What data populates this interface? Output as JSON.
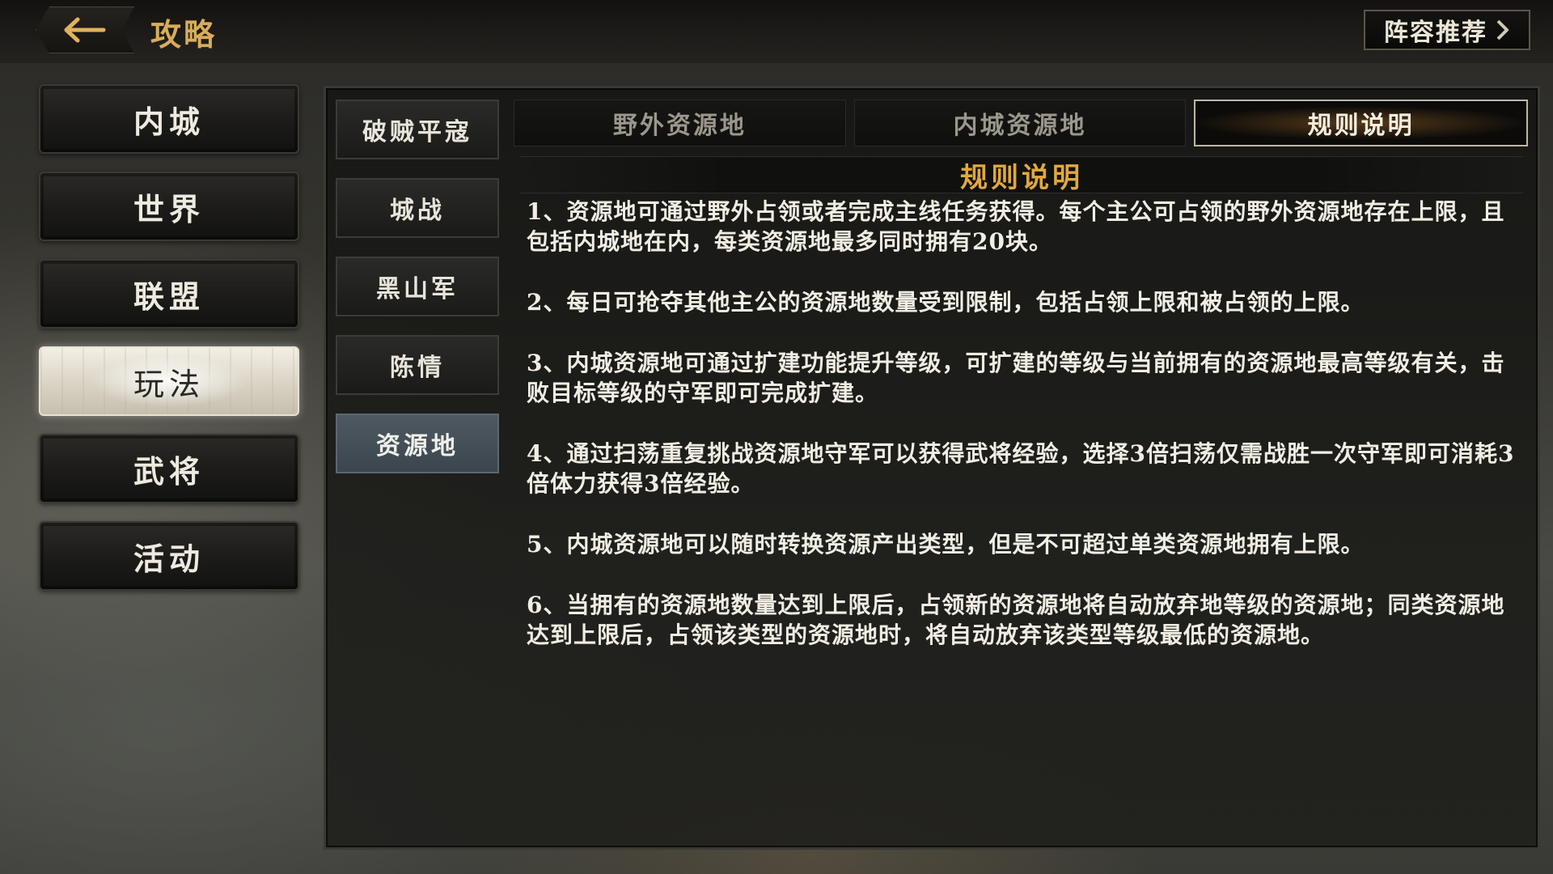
{
  "header": {
    "title": "攻略",
    "lineup_button": "阵容推荐"
  },
  "left_nav": {
    "items": [
      {
        "label": "内城"
      },
      {
        "label": "世界"
      },
      {
        "label": "联盟"
      },
      {
        "label": "玩法"
      },
      {
        "label": "武将"
      },
      {
        "label": "活动"
      }
    ],
    "active": "玩法"
  },
  "sub_nav": {
    "items": [
      {
        "label": "破贼平寇"
      },
      {
        "label": "城战"
      },
      {
        "label": "黑山军"
      },
      {
        "label": "陈情"
      },
      {
        "label": "资源地"
      }
    ],
    "active": "资源地"
  },
  "tabs": [
    {
      "label": "野外资源地"
    },
    {
      "label": "内城资源地"
    },
    {
      "label": "规则说明"
    }
  ],
  "active_tab": "规则说明",
  "content": {
    "title": "规则说明",
    "rules": [
      "1、资源地可通过野外占领或者完成主线任务获得。每个主公可占领的野外资源地存在上限，且包括内城地在内，每类资源地最多同时拥有20块。",
      "2、每日可抢夺其他主公的资源地数量受到限制，包括占领上限和被占领的上限。",
      "3、内城资源地可通过扩建功能提升等级，可扩建的等级与当前拥有的资源地最高等级有关，击败目标等级的守军即可完成扩建。",
      "4、通过扫荡重复挑战资源地守军可以获得武将经验，选择3倍扫荡仅需战胜一次守军即可消耗3倍体力获得3倍经验。",
      "5、内城资源地可以随时转换资源产出类型，但是不可超过单类资源地拥有上限。",
      "6、当拥有的资源地数量达到上限后，占领新的资源地将自动放弃地等级的资源地；同类资源地达到上限后，占领该类型的资源地时，将自动放弃该类型等级最低的资源地。"
    ]
  },
  "icons": {
    "back": "back-arrow-icon",
    "lineup": "chevron-right-icon"
  },
  "colors": {
    "title_gold": "#d9ac5a",
    "content_title": "#e1a83d",
    "active_sub_item": "#4e5962"
  }
}
